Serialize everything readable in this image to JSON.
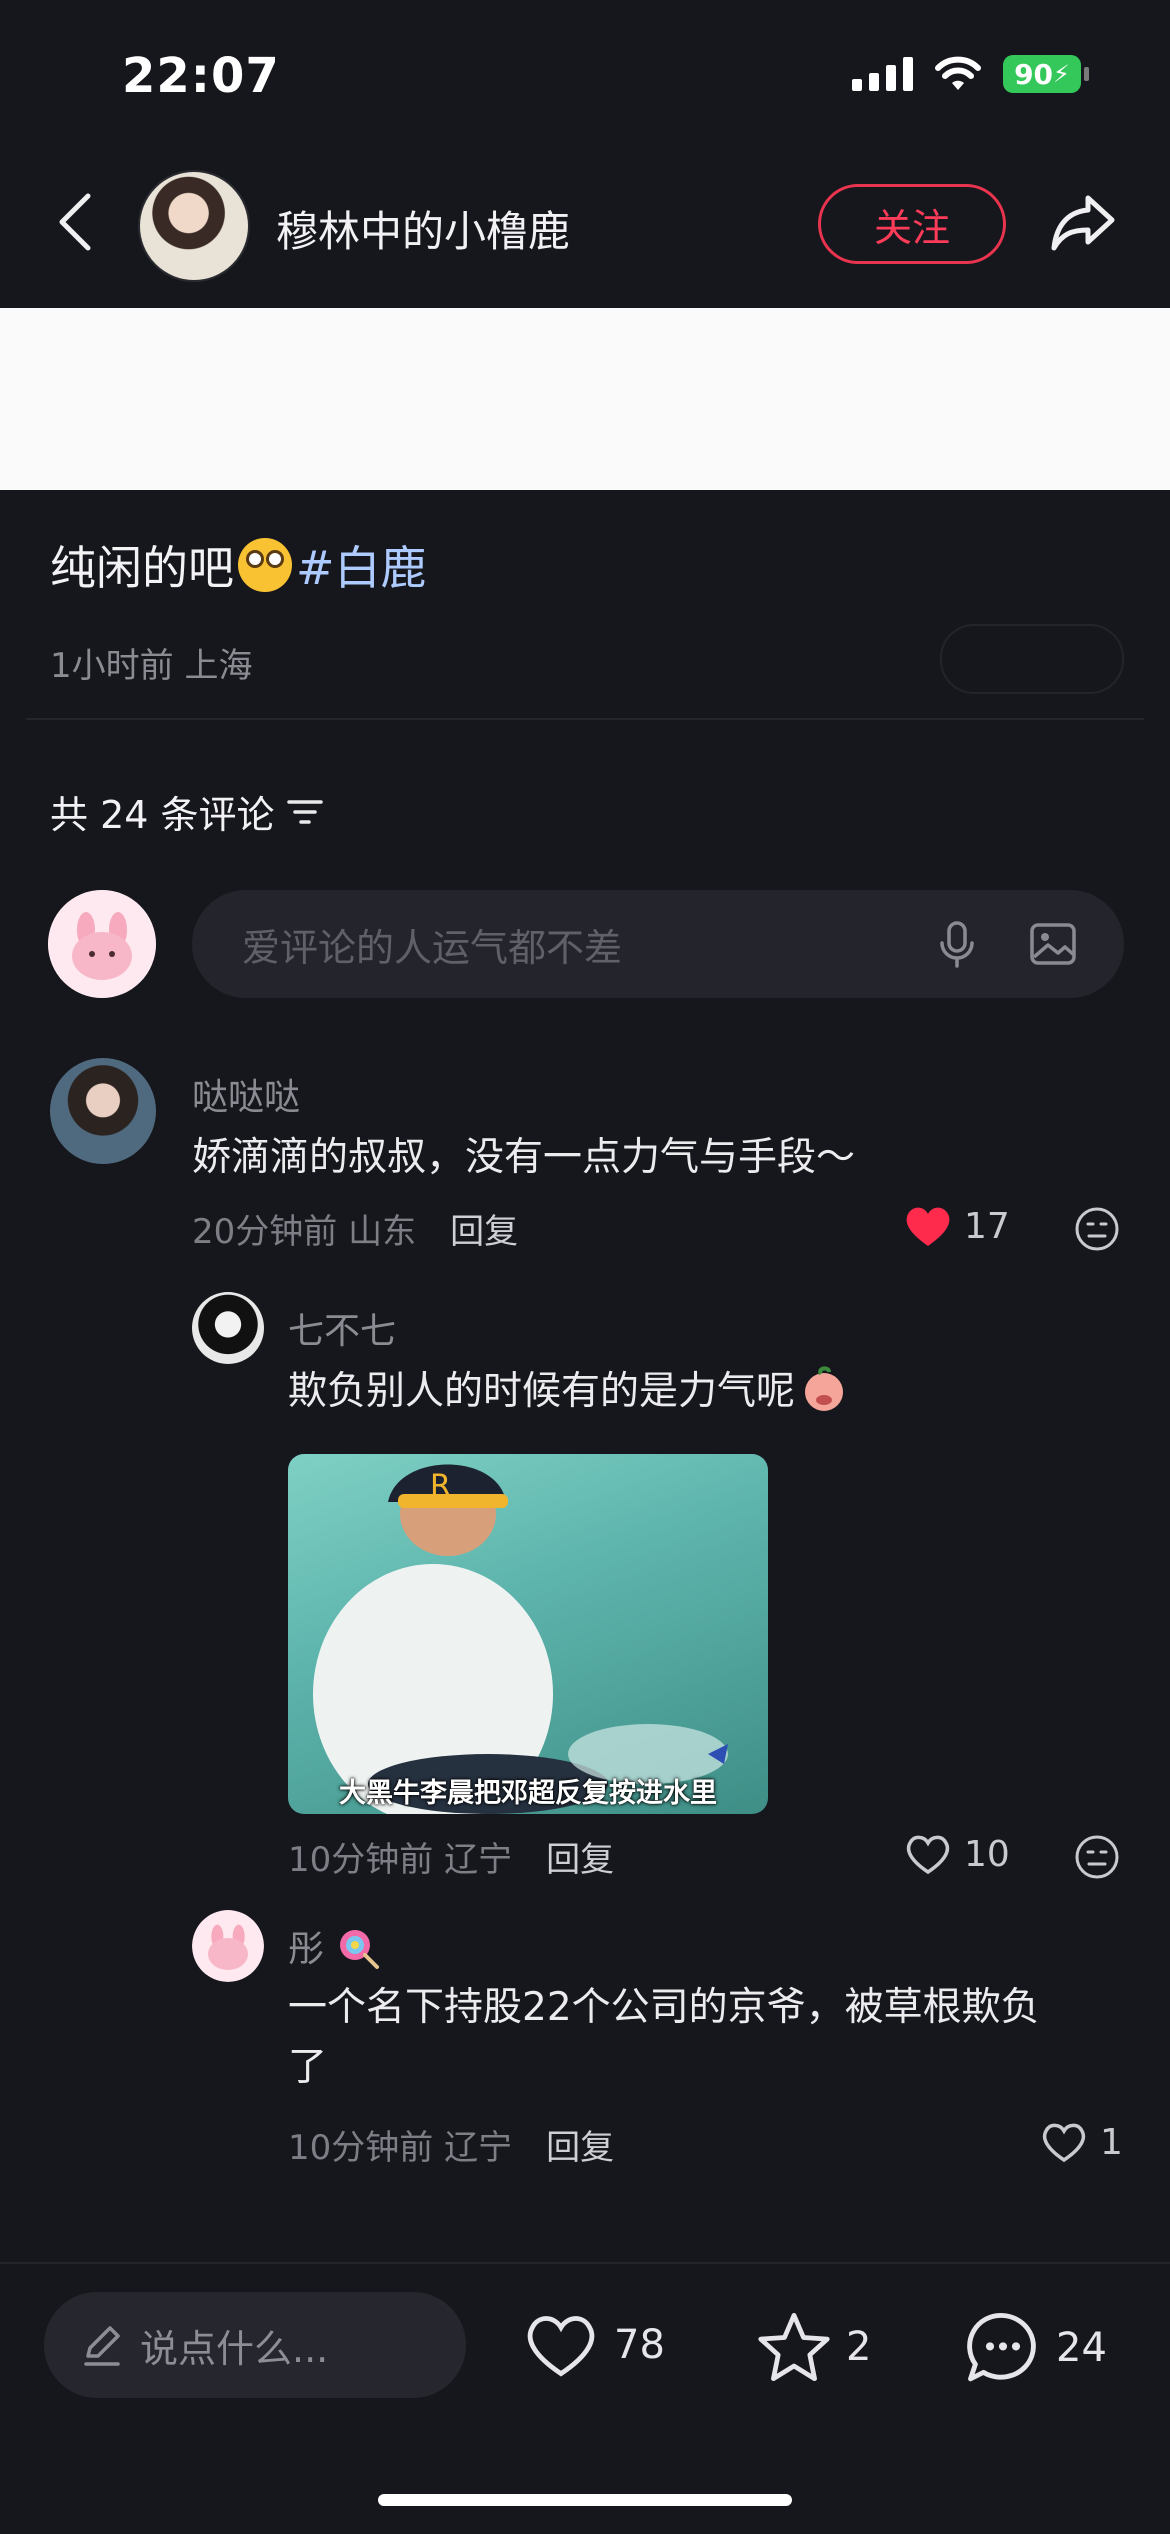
{
  "status_bar": {
    "time": "22:07",
    "battery": "90"
  },
  "header": {
    "author": "穆林中的小橹鹿",
    "follow_label": "关注"
  },
  "post": {
    "text_before": "纯闲的吧",
    "hashtag": "#白鹿",
    "meta": "1小时前 上海"
  },
  "comments_header": {
    "count_label": "共 24 条评论"
  },
  "comment_input": {
    "placeholder": "爱评论的人运气都不差"
  },
  "comments": [
    {
      "name": "哒哒哒",
      "text": "娇滴滴的叔叔，没有一点力气与手段～",
      "time": "20分钟前",
      "location": "山东",
      "reply_label": "回复",
      "likes": "17",
      "liked": true
    },
    {
      "name": "七不七",
      "text": "欺负别人的时候有的是力气呢",
      "image_caption": "大黑牛李晨把邓超反复按进水里",
      "time": "10分钟前",
      "location": "辽宁",
      "reply_label": "回复",
      "likes": "10"
    },
    {
      "name": "彤",
      "text_line1": "一个名下持股22个公司的京爷，被草根欺负",
      "text_line2": "了",
      "time": "10分钟前",
      "location": "辽宁",
      "reply_label": "回复",
      "likes": "1"
    }
  ],
  "bottom_bar": {
    "say_placeholder": "说点什么...",
    "likes": "78",
    "favorites": "2",
    "comments": "24"
  },
  "colors": {
    "accent": "#ff3b5a",
    "background": "#16171d",
    "hashtag": "#aecbff",
    "battery": "#34c759"
  }
}
